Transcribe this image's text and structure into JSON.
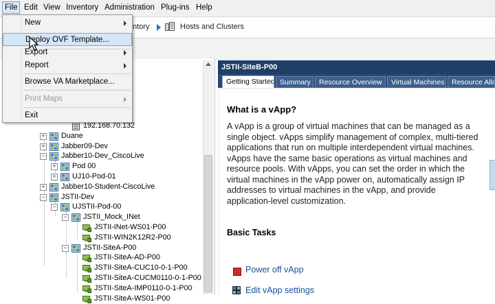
{
  "menubar": {
    "items": [
      "File",
      "Edit",
      "View",
      "Inventory",
      "Administration",
      "Plug-ins",
      "Help"
    ]
  },
  "nav": {
    "inventory": "ntory",
    "hosts": "Hosts and Clusters"
  },
  "file_menu": {
    "items": [
      {
        "label": "New",
        "submenu": true,
        "enabled": true
      },
      {
        "label": "Deploy OVF Template...",
        "submenu": false,
        "enabled": true,
        "highlighted": true
      },
      {
        "label": "Export",
        "submenu": true,
        "enabled": true
      },
      {
        "label": "Report",
        "submenu": true,
        "enabled": true
      },
      {
        "label": "Browse VA Marketplace...",
        "submenu": false,
        "enabled": true
      },
      {
        "label": "Print Maps",
        "submenu": true,
        "enabled": false
      },
      {
        "label": "Exit",
        "submenu": false,
        "enabled": true
      }
    ]
  },
  "tree": {
    "rows": [
      {
        "label": "192.168.70.132",
        "type": "host",
        "expand": ""
      },
      {
        "label": "Duane",
        "type": "vapp",
        "expand": "+"
      },
      {
        "label": "Jabber09-Dev",
        "type": "vapp",
        "expand": "+"
      },
      {
        "label": "Jabber10-Dev_CiscoLive",
        "type": "vapp",
        "expand": "-"
      },
      {
        "label": "Pod 00",
        "type": "vapp",
        "expand": "+"
      },
      {
        "label": "UJ10-Pod-01",
        "type": "vapp",
        "expand": "+"
      },
      {
        "label": "Jabber10-Student-CiscoLive",
        "type": "vapp",
        "expand": "+"
      },
      {
        "label": "JSTII-Dev",
        "type": "vapp",
        "expand": "-"
      },
      {
        "label": "UJSTII-Pod-00",
        "type": "vapp",
        "expand": "-"
      },
      {
        "label": "JSTII_Mock_INet",
        "type": "vapp",
        "expand": "-"
      },
      {
        "label": "JSTII-INet-WS01-P00",
        "type": "vm",
        "expand": ""
      },
      {
        "label": "JSTII-WIN2K12R2-P00",
        "type": "vm",
        "expand": ""
      },
      {
        "label": "JSTII-SiteA-P00",
        "type": "vapp",
        "expand": "-"
      },
      {
        "label": "JSTII-SiteA-AD-P00",
        "type": "vm",
        "expand": ""
      },
      {
        "label": "JSTII-SiteA-CUC10-0-1-P00",
        "type": "vm",
        "expand": ""
      },
      {
        "label": "JSTII-SiteA-CUCM0110-0-1-P00",
        "type": "vm",
        "expand": ""
      },
      {
        "label": "JSTII-SiteA-IMP0110-0-1-P00",
        "type": "vm",
        "expand": ""
      },
      {
        "label": "JSTII-SiteA-WS01-P00",
        "type": "vm",
        "expand": ""
      }
    ]
  },
  "right_panel": {
    "title": "JSTII-SiteB-P00",
    "tabs": [
      "Getting Started",
      "Summary",
      "Resource Overview",
      "Virtual Machines",
      "Resource Allo"
    ],
    "what_title": "What is a vApp?",
    "what_body": "A vApp is a group of virtual machines that can be managed as a single object. vApps simplify management of complex, multi-tiered applications that run on multiple interdependent virtual machines. vApps have the same basic operations as virtual machines and resource pools. With vApps, you can set the order in which the virtual machines in the vApp power on, automatically assign IP addresses to virtual machines in the vApp, and provide application-level customization.",
    "basic_tasks_title": "Basic Tasks",
    "tasks": [
      "Power off vApp",
      "Edit vApp settings"
    ]
  },
  "colors": {
    "title_bar": "#1f3f66",
    "menu_highlight": "#d5e6f8",
    "link": "#1a4f9a",
    "power_off": "#d22a2a"
  }
}
